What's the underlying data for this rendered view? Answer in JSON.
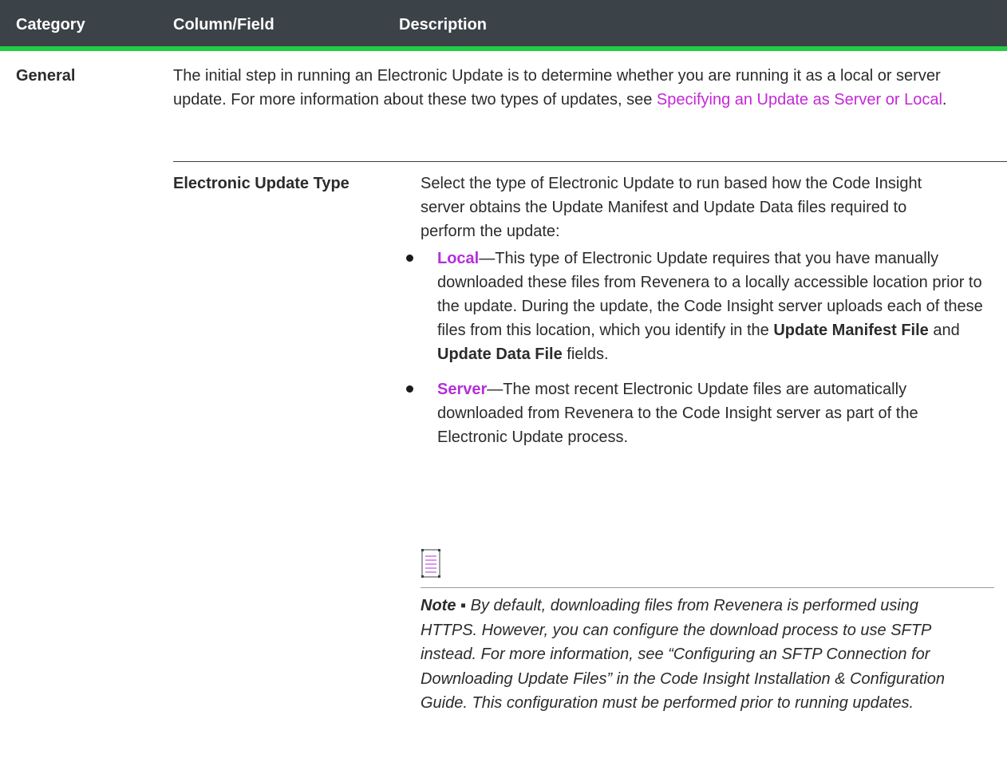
{
  "table": {
    "headers": {
      "category": "Category",
      "column_field": "Column/Field",
      "description": "Description"
    },
    "category": "General",
    "general_description": {
      "text_before_link": "The initial step in running an Electronic Update is to determine whether you are running it as a local or server update. For more information about these two types of updates, see ",
      "link_text": "Specifying an Update as Server or Local",
      "text_after_link": "."
    },
    "row": {
      "field": "Electronic Update Type",
      "description": "Select the type of Electronic Update to run based how the Code Insight server obtains the Update Manifest and Update Data files required to perform the update:",
      "bullets": [
        {
          "term": "Local",
          "text_a": "—This type of Electronic Update requires that you have manually downloaded these files from Revenera to a locally accessible location prior to the update. During the update, the Code Insight server uploads each of these files from this location, which you identify in the ",
          "bold_1": "Update Manifest File",
          "text_b": " and ",
          "bold_2": "Update Data File",
          "text_c": " fields."
        },
        {
          "term": "Server",
          "text_a": "—The most recent Electronic Update files are automatically downloaded from Revenera to the Code Insight server as part of the Electronic Update process."
        }
      ],
      "note": {
        "icon": "note-document-icon",
        "label": "Note ▪",
        "text": " By default, downloading files from Revenera is performed using HTTPS. However, you can configure the download process to use SFTP instead. For more information, see “Configuring an SFTP Connection for Downloading Update Files” in the Code Insight Installation & Configuration Guide. This configuration must be performed prior to running updates."
      }
    }
  },
  "colors": {
    "header_bg": "#3b4248",
    "header_accent": "#22cc44",
    "link": "#c428d8",
    "term": "#b42fd8"
  }
}
